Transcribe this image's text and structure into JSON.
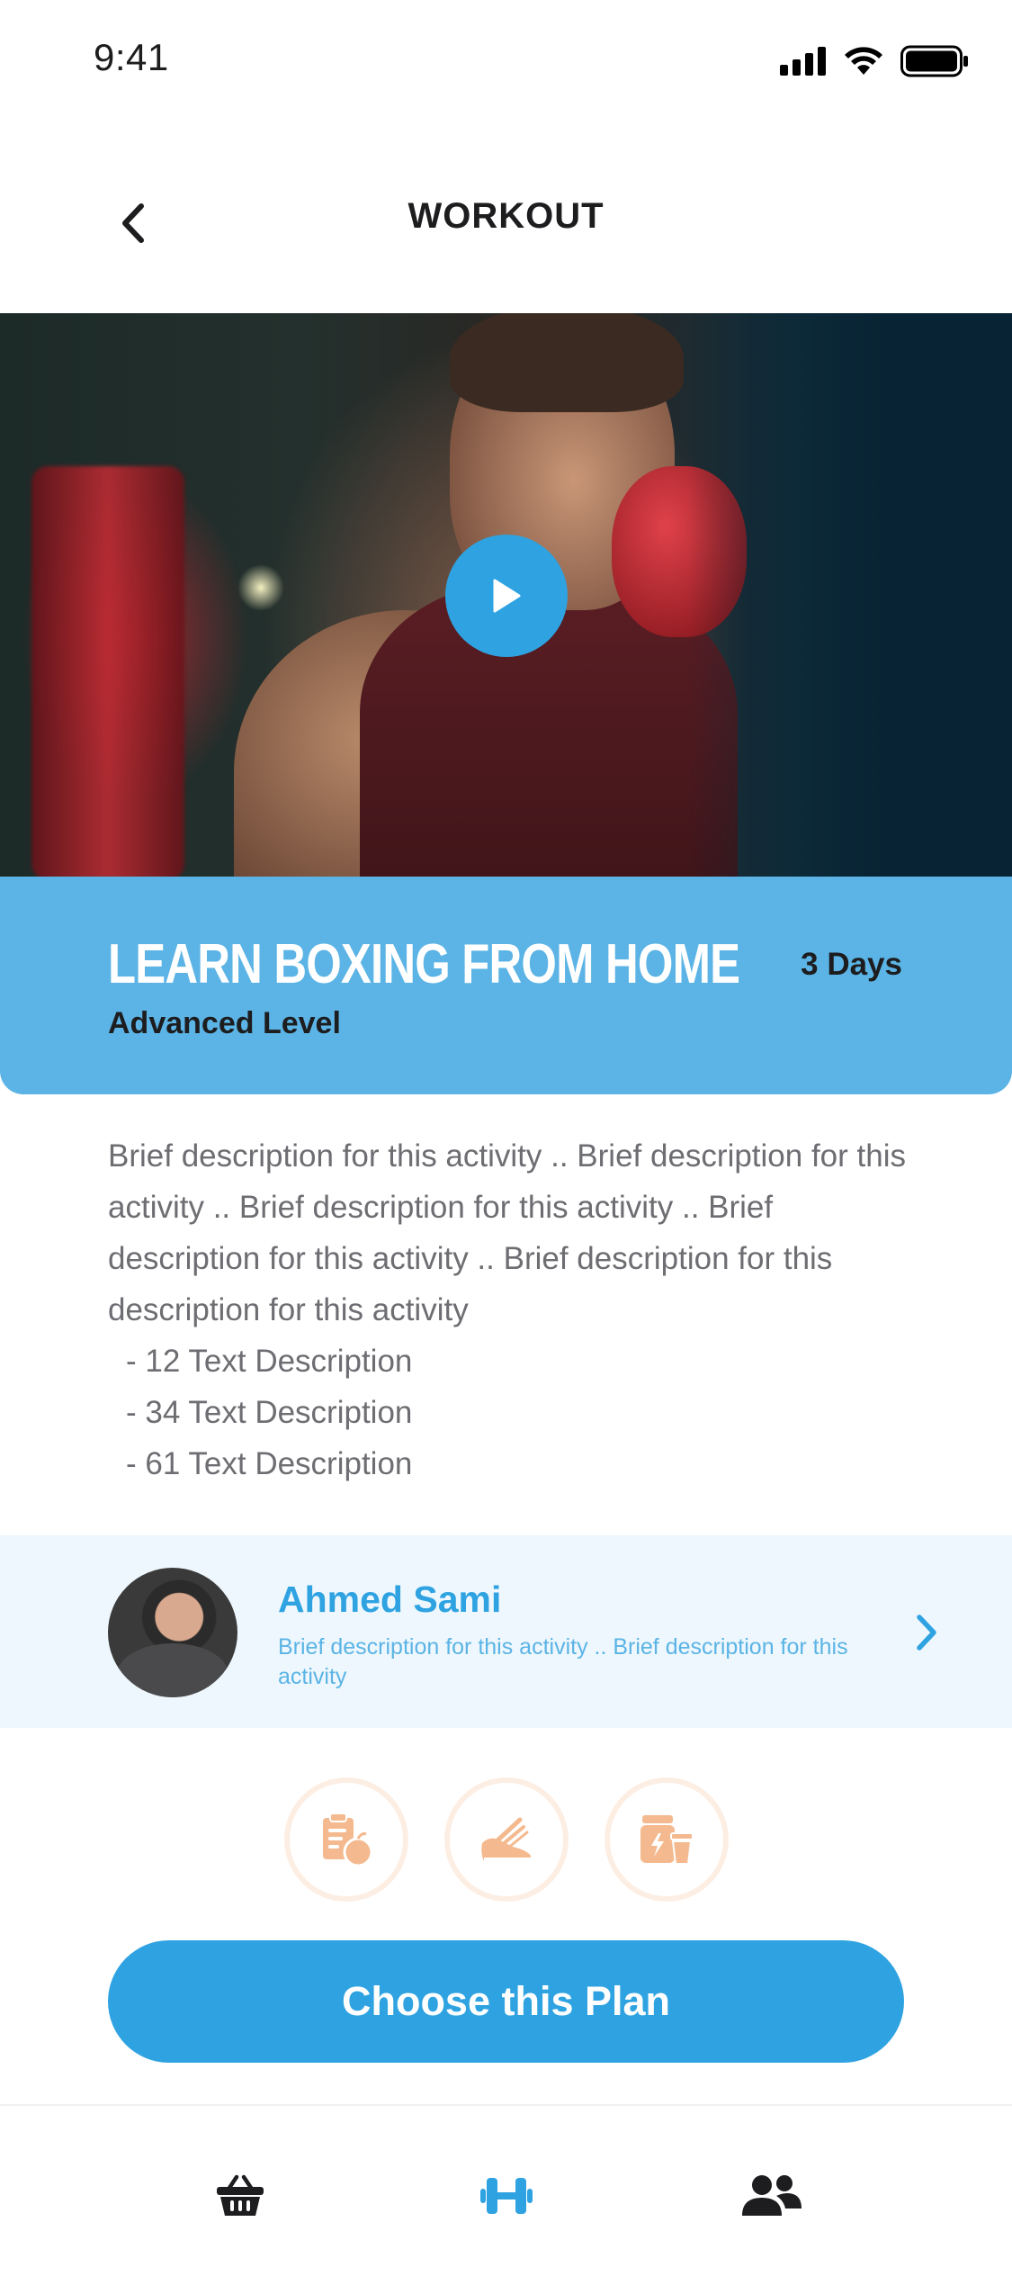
{
  "status_bar": {
    "time": "9:41"
  },
  "header": {
    "title": "WORKOUT",
    "back_icon": "chevron-left-icon"
  },
  "hero": {
    "play_icon": "play-icon"
  },
  "program": {
    "title": "LEARN BOXING FROM HOME",
    "level": "Advanced Level",
    "duration": "3 Days"
  },
  "description": {
    "text": "Brief description for this activity .. Brief description for this activity .. Brief description for this activity .. Brief description for this activity .. Brief description for this description for this activity",
    "items": [
      "- 12 Text Description",
      "- 34  Text Description",
      "- 61 Text Description"
    ]
  },
  "coach": {
    "name": "Ahmed Sami",
    "bio": "Brief description for this activity .. Brief description for this activity"
  },
  "features": [
    {
      "icon": "nutrition-plan-icon"
    },
    {
      "icon": "running-shoe-icon"
    },
    {
      "icon": "supplements-icon"
    }
  ],
  "cta": {
    "label": "Choose this Plan"
  },
  "tabbar": {
    "items": [
      {
        "icon": "basket-icon",
        "active": false
      },
      {
        "icon": "dumbbell-icon",
        "active": true
      },
      {
        "icon": "community-icon",
        "active": false
      }
    ]
  },
  "colors": {
    "accent": "#2fa3e1",
    "band": "#5bb4e5",
    "feature_icon": "#f4b98e",
    "coach_bg": "#eef7fd"
  }
}
